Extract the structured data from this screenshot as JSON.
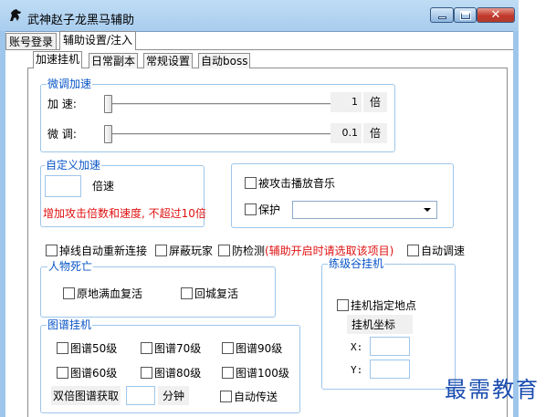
{
  "window": {
    "title": "武神赵子龙黑马辅助",
    "colors": {
      "frame": "#9ec6ea",
      "group_title": "#0a56c8",
      "warning": "#e01010",
      "watermark": "#1a4db0"
    }
  },
  "tabs": {
    "login": "账号登录",
    "settings": "辅助设置/注入"
  },
  "subtabs": {
    "speed": "加速挂机",
    "daily": "日常副本",
    "general": "常规设置",
    "auto_boss": "自动boss"
  },
  "fine_tune": {
    "title": "微调加速",
    "speed_label": "加    速:",
    "speed_value": "1",
    "speed_level": 0,
    "unit": "倍",
    "tune_label": "微    调:",
    "tune_value": "0.1",
    "tune_level": 0
  },
  "custom_speed": {
    "title": "自定义加速",
    "input_value": "",
    "unit": "倍速",
    "warning": "增加攻击倍数和速度, 不超过10倍"
  },
  "misc": {
    "attacked_music": "被攻击播放音乐",
    "protect": "保护",
    "protect_selected": ""
  },
  "options_row": {
    "reconnect": "掉线自动重新连接",
    "block_players": "屏蔽玩家",
    "anti_detect": "防检测",
    "anti_detect_hint": "(辅助开启时请选取该项目)",
    "auto_speed": "自动调速"
  },
  "death": {
    "title": "人物死亡",
    "revive_full": "原地满血复活",
    "return_city": "回城复活"
  },
  "leveling": {
    "title": "练级谷挂机",
    "specified_point": "挂机指定地点",
    "coords_label": "挂机坐标",
    "x_label": "X:",
    "y_label": "Y:",
    "x_value": "",
    "y_value": ""
  },
  "tujian": {
    "title": "图谱挂机",
    "items": [
      "图谱50级",
      "图谱70级",
      "图谱90级",
      "图谱60级",
      "图谱80级",
      "图谱100级"
    ],
    "double_label": "双倍图谱获取",
    "minutes_value": "",
    "minutes_unit": "分钟",
    "auto_teleport": "自动传送"
  },
  "watermark": "最需教育"
}
